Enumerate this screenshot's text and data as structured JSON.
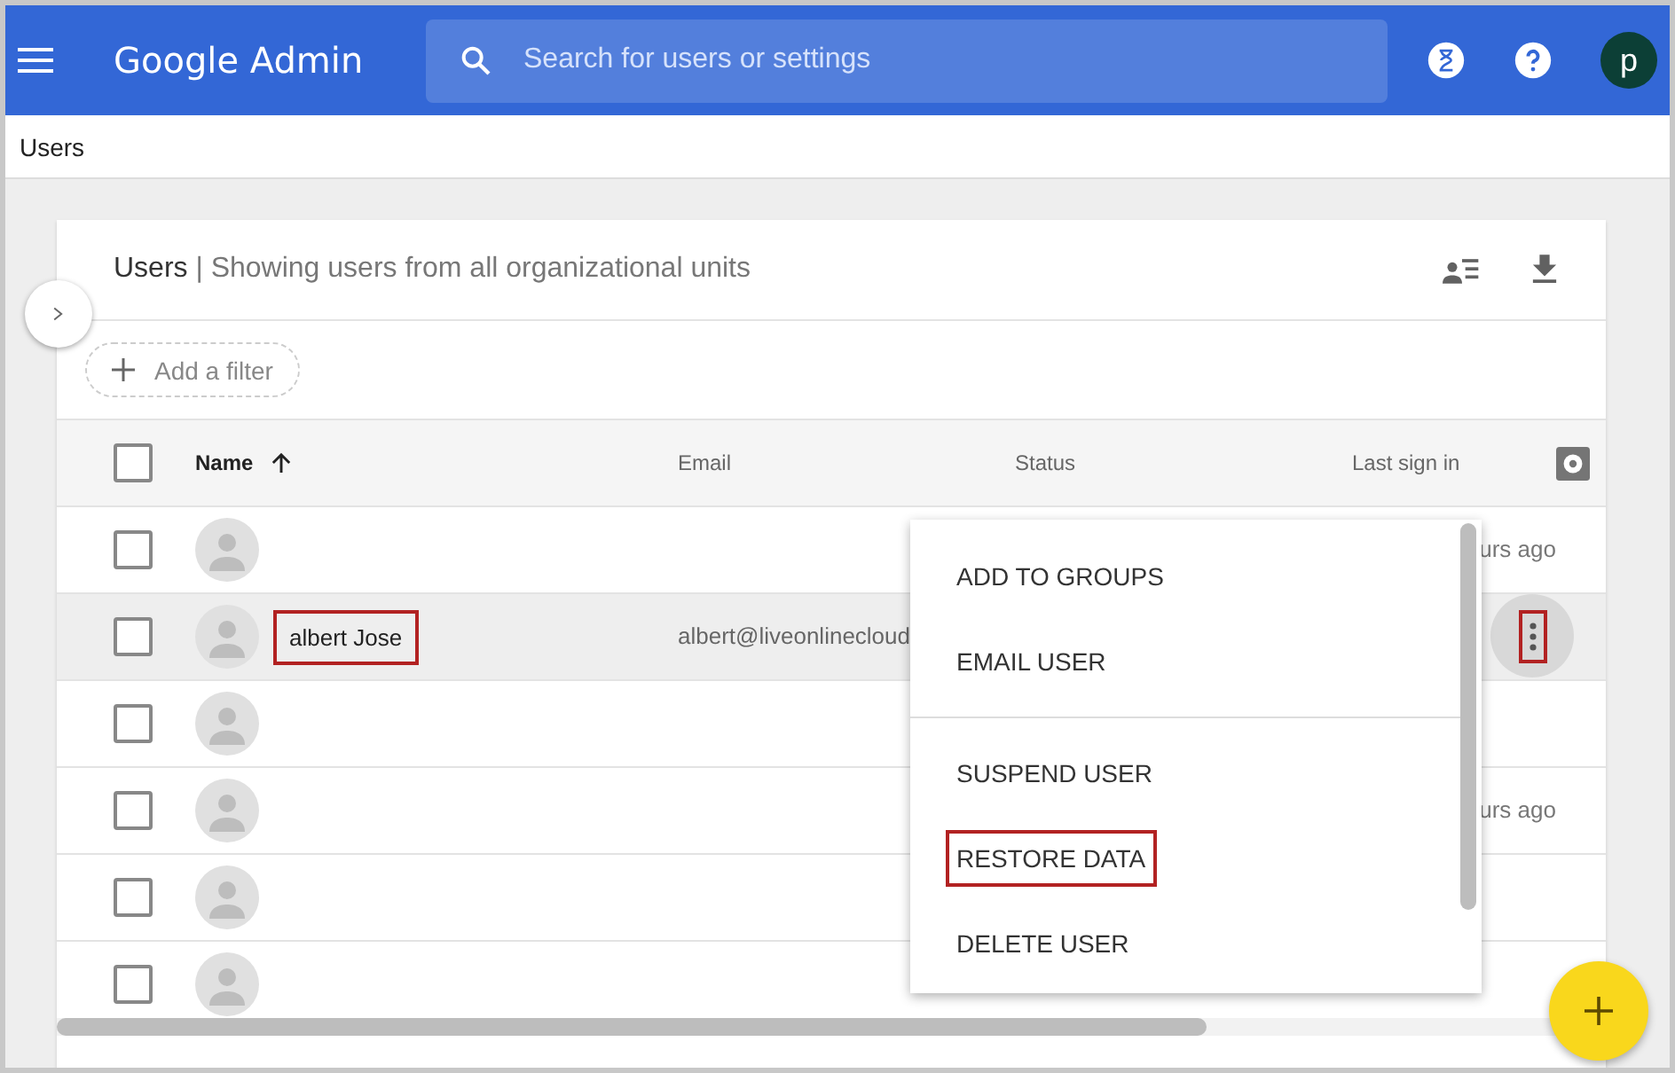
{
  "top_bar": {
    "title": "Google Admin",
    "search": {
      "placeholder": "Search for users or settings"
    },
    "avatar_letter": "p"
  },
  "breadcrumb": "Users",
  "card": {
    "title": "Users",
    "subtitle": "| Showing users from all organizational units",
    "filter_button": "Add a filter"
  },
  "table": {
    "select_all_checked": false,
    "columns": [
      {
        "label": "Name",
        "sorted": true
      },
      {
        "label": "Email",
        "sorted": false
      },
      {
        "label": "Status",
        "sorted": false
      },
      {
        "label": "Last sign in",
        "sorted": false
      }
    ],
    "rows": [
      {
        "last_sign_in": "urs ago",
        "selected": false,
        "checked": false
      },
      {
        "name": "albert Jose",
        "email": "albert@liveonlinecloud",
        "highlighted": true,
        "selected": true,
        "checked": false
      },
      {
        "selected": false,
        "checked": false
      },
      {
        "last_sign_in": "urs ago",
        "selected": false,
        "checked": false
      },
      {
        "selected": false,
        "checked": false
      },
      {
        "selected": false,
        "checked": false
      }
    ]
  },
  "more_button": {
    "highlighted": true
  },
  "context_menu": {
    "items": [
      {
        "kind": "item",
        "label": "ADD TO GROUPS",
        "highlighted": false
      },
      {
        "kind": "item",
        "label": "EMAIL USER",
        "highlighted": false
      },
      {
        "kind": "divider"
      },
      {
        "kind": "item",
        "label": "SUSPEND USER",
        "highlighted": false
      },
      {
        "kind": "item",
        "label": "RESTORE DATA",
        "highlighted": true
      },
      {
        "kind": "item",
        "label": "DELETE USER",
        "highlighted": false
      }
    ]
  }
}
